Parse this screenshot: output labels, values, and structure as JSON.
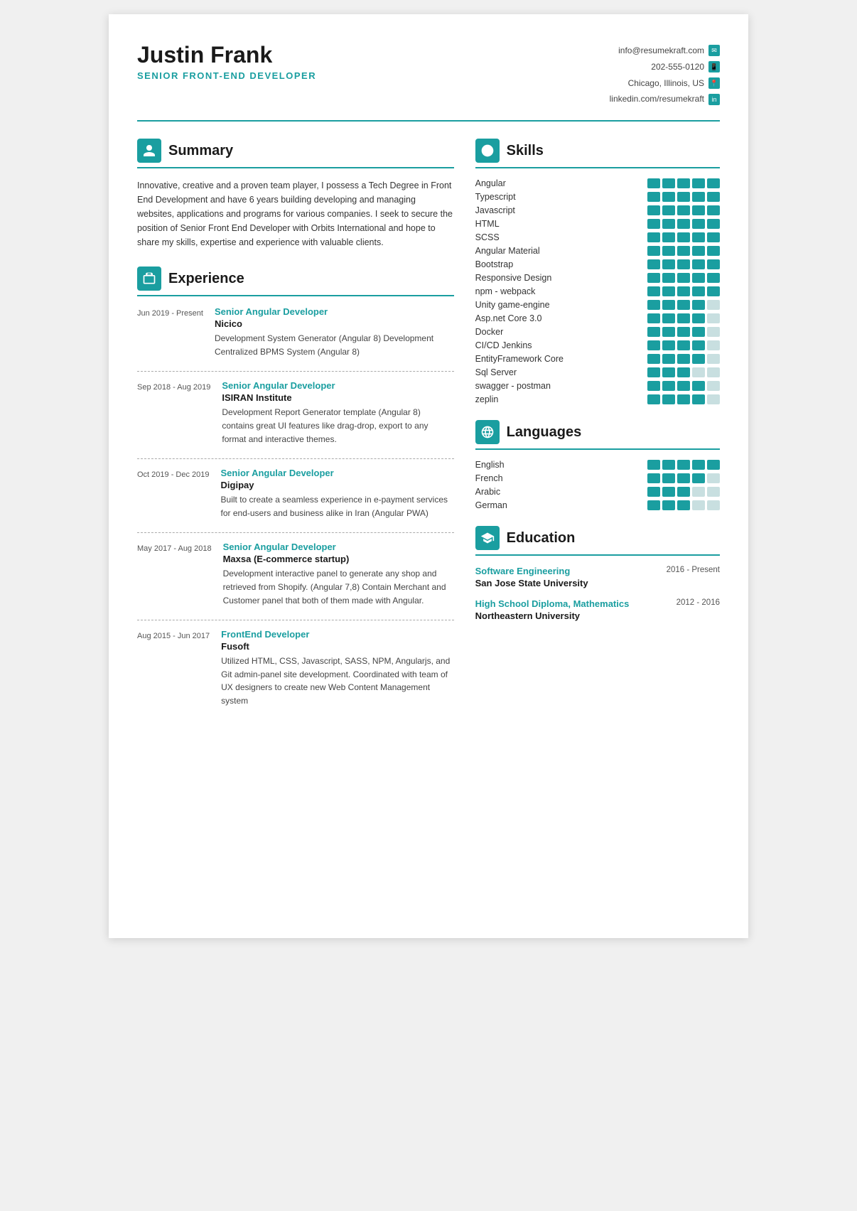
{
  "header": {
    "first_name": "Justin",
    "last_name": " Frank",
    "title": "SENIOR FRONT-END DEVELOPER",
    "contact": {
      "email": "info@resumekraft.com",
      "phone": "202-555-0120",
      "location": "Chicago, Illinois, US",
      "linkedin": "linkedin.com/resumekraft"
    }
  },
  "summary": {
    "heading": "Summary",
    "text": "Innovative, creative and a proven team player, I possess a Tech Degree in Front End Development and have 6 years building developing and managing websites, applications and programs for various companies. I seek to secure the position of Senior Front End Developer with Orbits International and hope to share my skills, expertise and experience with valuable clients."
  },
  "experience": {
    "heading": "Experience",
    "items": [
      {
        "date": "Jun 2019 - Present",
        "title": "Senior Angular Developer",
        "company": "Nicico",
        "desc": "Development System Generator (Angular 8) Development Centralized BPMS System (Angular 8)"
      },
      {
        "date": "Sep 2018 - Aug 2019",
        "title": "Senior Angular Developer",
        "company": "ISIRAN Institute",
        "desc": "Development Report Generator template (Angular 8) contains great UI features like drag-drop, export to any format and interactive themes."
      },
      {
        "date": "Oct 2019 - Dec 2019",
        "title": "Senior Angular Developer",
        "company": "Digipay",
        "desc": "Built to create a seamless experience in e-payment services for end-users and business alike in Iran (Angular PWA)"
      },
      {
        "date": "May 2017 - Aug 2018",
        "title": "Senior Angular Developer",
        "company": "Maxsa (E-commerce startup)",
        "desc": "Development interactive panel to generate any shop and retrieved from Shopify. (Angular 7,8) Contain Merchant and Customer panel that both of them made with Angular."
      },
      {
        "date": "Aug 2015 - Jun 2017",
        "title": "FrontEnd Developer",
        "company": "Fusoft",
        "desc": "Utilized HTML, CSS, Javascript, SASS, NPM, Angularjs, and Git admin-panel site development. Coordinated with team of UX designers to create new Web Content Management system"
      }
    ]
  },
  "skills": {
    "heading": "Skills",
    "items": [
      {
        "name": "Angular",
        "filled": 5,
        "total": 5
      },
      {
        "name": "Typescript",
        "filled": 5,
        "total": 5
      },
      {
        "name": "Javascript",
        "filled": 5,
        "total": 5
      },
      {
        "name": "HTML",
        "filled": 5,
        "total": 5
      },
      {
        "name": "SCSS",
        "filled": 5,
        "total": 5
      },
      {
        "name": "Angular Material",
        "filled": 5,
        "total": 5
      },
      {
        "name": "Bootstrap",
        "filled": 5,
        "total": 5
      },
      {
        "name": "Responsive Design",
        "filled": 5,
        "total": 5
      },
      {
        "name": "npm - webpack",
        "filled": 5,
        "total": 5
      },
      {
        "name": "Unity game-engine",
        "filled": 4,
        "total": 5
      },
      {
        "name": "Asp.net Core 3.0",
        "filled": 4,
        "total": 5
      },
      {
        "name": "Docker",
        "filled": 4,
        "total": 5
      },
      {
        "name": "CI/CD Jenkins",
        "filled": 4,
        "total": 5
      },
      {
        "name": "EntityFramework Core",
        "filled": 4,
        "total": 5
      },
      {
        "name": "Sql Server",
        "filled": 3,
        "total": 5
      },
      {
        "name": "swagger - postman",
        "filled": 4,
        "total": 5
      },
      {
        "name": "zeplin",
        "filled": 4,
        "total": 5
      }
    ]
  },
  "languages": {
    "heading": "Languages",
    "items": [
      {
        "name": "English",
        "filled": 5,
        "total": 5
      },
      {
        "name": "French",
        "filled": 4,
        "total": 5
      },
      {
        "name": "Arabic",
        "filled": 3,
        "total": 5
      },
      {
        "name": "German",
        "filled": 3,
        "total": 5
      }
    ]
  },
  "education": {
    "heading": "Education",
    "items": [
      {
        "degree": "Software Engineering",
        "years": "2016 - Present",
        "school": "San Jose State University"
      },
      {
        "degree": "High School Diploma, Mathematics",
        "years": "2012 - 2016",
        "school": "Northeastern University"
      }
    ]
  }
}
